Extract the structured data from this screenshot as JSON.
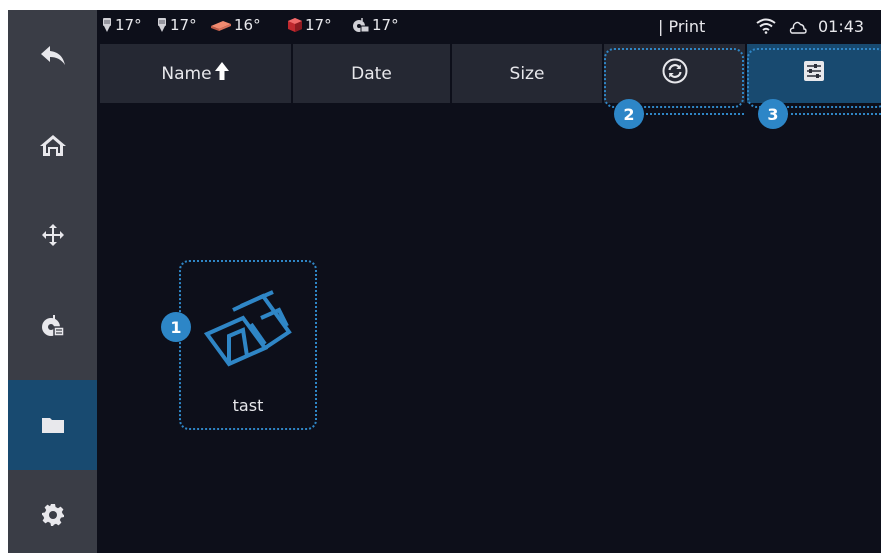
{
  "status_bar": {
    "temperatures": [
      {
        "icon": "nozzle-1-icon",
        "value": "17°"
      },
      {
        "icon": "nozzle-2-icon",
        "value": "17°"
      },
      {
        "icon": "heated-bed-icon",
        "value": "16°"
      },
      {
        "icon": "chamber-icon",
        "value": "17°"
      },
      {
        "icon": "filament-spool-icon",
        "value": "17°"
      }
    ],
    "page_label": "| Print",
    "wifi_icon": "wifi-icon",
    "cloud_icon": "cloud-icon",
    "time": "01:43"
  },
  "sidebar": {
    "items": [
      {
        "name": "back",
        "icon": "back-arrow-icon",
        "active": false
      },
      {
        "name": "home",
        "icon": "home-icon",
        "active": false
      },
      {
        "name": "move",
        "icon": "move-icon",
        "active": false
      },
      {
        "name": "filament",
        "icon": "filament-spool-icon",
        "active": false
      },
      {
        "name": "files",
        "icon": "folder-icon",
        "active": true
      },
      {
        "name": "settings",
        "icon": "gear-icon",
        "active": false
      }
    ]
  },
  "sort_tabs": [
    {
      "label": "Name",
      "icon": "sort-ascending-arrow-icon"
    },
    {
      "label": "Date"
    },
    {
      "label": "Size"
    }
  ],
  "actions": [
    {
      "name": "refresh",
      "icon": "refresh-icon"
    },
    {
      "name": "filter-settings",
      "icon": "sliders-icon"
    }
  ],
  "callouts": [
    "1",
    "2",
    "3"
  ],
  "files": [
    {
      "name": "tast",
      "icon": "gcode-file-thumbnail-icon"
    }
  ],
  "colors": {
    "background": "#0d0f1a",
    "sidebar": "#3a3d46",
    "tab": "#252833",
    "accent": "#184a70",
    "callout": "#2d86c7"
  }
}
